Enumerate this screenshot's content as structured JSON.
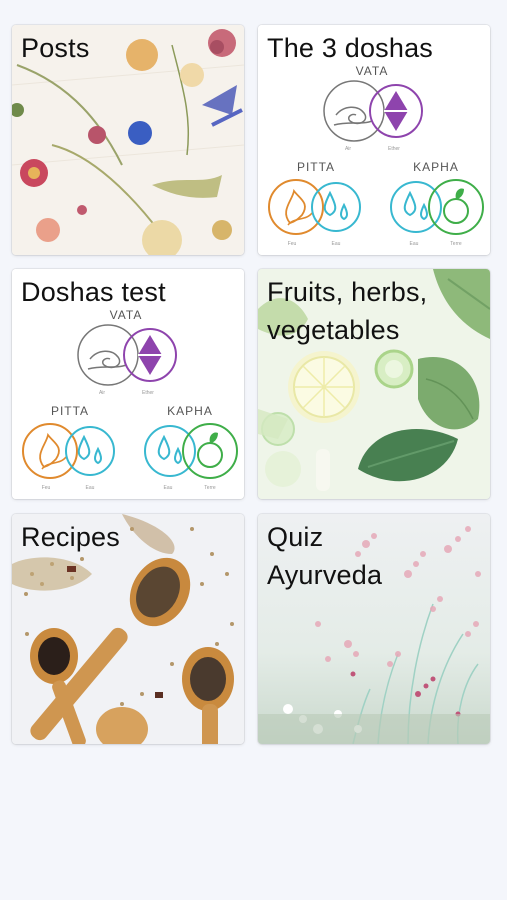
{
  "tiles": [
    {
      "id": "posts",
      "title": "Posts"
    },
    {
      "id": "three-doshas",
      "title": "The 3 doshas"
    },
    {
      "id": "doshas-test",
      "title": "Doshas test"
    },
    {
      "id": "fruits-herbs-vegetables",
      "title": "Fruits, herbs, vegetables"
    },
    {
      "id": "recipes",
      "title": "Recipes"
    },
    {
      "id": "quiz-ayurveda",
      "title": "Quiz Ayurveda"
    }
  ],
  "dosha_diagram": {
    "vata": "VATA",
    "pitta": "PITTA",
    "kapha": "KAPHA",
    "elements": {
      "air": "Air",
      "ether": "Ether",
      "fire": "Feu",
      "water": "Eau",
      "earth": "Terre"
    }
  },
  "colors": {
    "background": "#f4f6fb",
    "vata": "#8e44ad",
    "pitta": "#e08a2e",
    "kapha": "#38b8d0",
    "earth": "#3fae49"
  },
  "icons": [
    "air-icon",
    "ether-icon",
    "fire-icon",
    "water-icon",
    "earth-icon"
  ]
}
